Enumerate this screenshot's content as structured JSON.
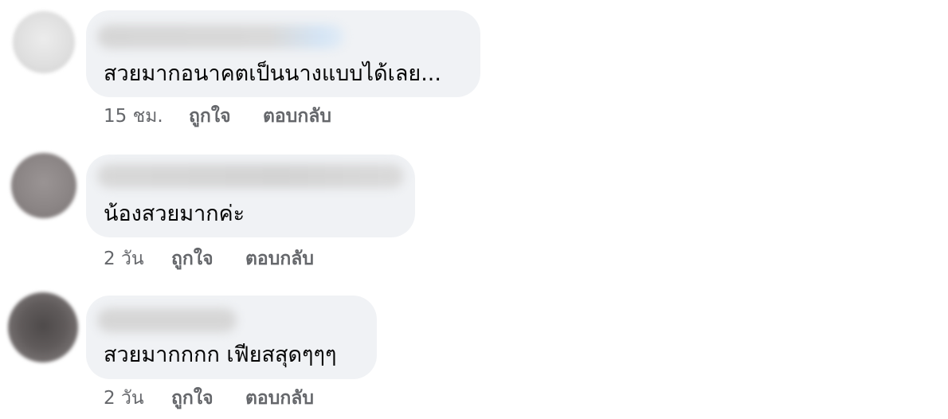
{
  "comments": [
    {
      "text": "สวยมากอนาคตเป็นนางแบบได้เลย...",
      "time": "15 ชม.",
      "like_label": "ถูกใจ",
      "reply_label": "ตอบกลับ"
    },
    {
      "text": "น้องสวยมากค่ะ",
      "time": "2 วัน",
      "like_label": "ถูกใจ",
      "reply_label": "ตอบกลับ"
    },
    {
      "text": "สวยมากกกก เฟียสสุดๆๆๆ",
      "time": "2 วัน",
      "like_label": "ถูกใจ",
      "reply_label": "ตอบกลับ"
    }
  ],
  "colors": {
    "bubble": "#f0f2f5",
    "text": "#050505",
    "meta": "#65676b"
  }
}
